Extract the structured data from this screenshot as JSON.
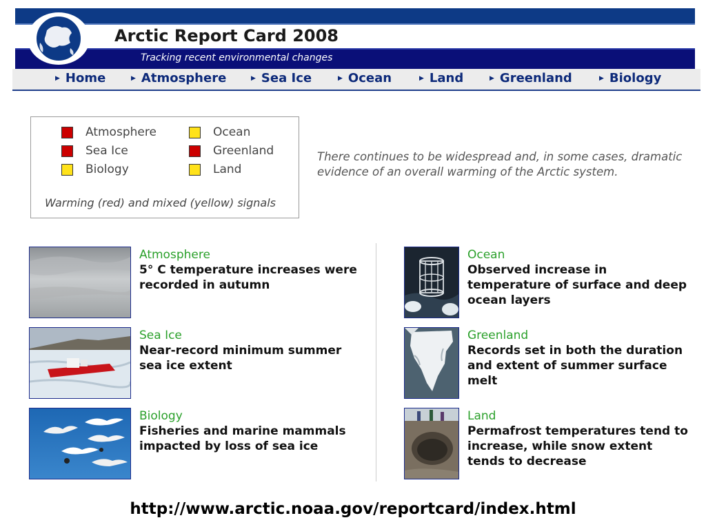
{
  "header": {
    "title": "Arctic Report Card 2008",
    "tagline": "Tracking recent environmental changes",
    "logo_icon": "arctic-globe-icon"
  },
  "nav": [
    {
      "label": "Home"
    },
    {
      "label": "Atmosphere"
    },
    {
      "label": "Sea Ice"
    },
    {
      "label": "Ocean"
    },
    {
      "label": "Land"
    },
    {
      "label": "Greenland"
    },
    {
      "label": "Biology"
    }
  ],
  "legend": {
    "items": [
      {
        "label": "Atmosphere",
        "signal": "red"
      },
      {
        "label": "Sea Ice",
        "signal": "red"
      },
      {
        "label": "Biology",
        "signal": "yellow"
      },
      {
        "label": "Ocean",
        "signal": "yellow"
      },
      {
        "label": "Greenland",
        "signal": "red"
      },
      {
        "label": "Land",
        "signal": "yellow"
      }
    ],
    "caption": "Warming (red) and mixed (yellow) signals",
    "colors": {
      "red": "#cc0000",
      "yellow": "#ffe21a"
    }
  },
  "intro": "There continues to be widespread and, in some cases, dramatic evidence of an overall warming of the Arctic system.",
  "topics": [
    {
      "category": "Atmosphere",
      "description": "5° C temperature increases were recorded in autumn",
      "image": "cloudy-sky-image"
    },
    {
      "category": "Sea Ice",
      "description": "Near-record minimum summer sea ice extent",
      "image": "icebreaker-ship-image"
    },
    {
      "category": "Biology",
      "description": "Fisheries and marine mammals impacted by loss of sea ice",
      "image": "flying-birds-image"
    },
    {
      "category": "Ocean",
      "description": "Observed increase in temperature of surface and deep ocean layers",
      "image": "ocean-instrument-image"
    },
    {
      "category": "Greenland",
      "description": "Records set in both the duration and extent of summer surface melt",
      "image": "greenland-satellite-image"
    },
    {
      "category": "Land",
      "description": "Permafrost temperatures tend to increase, while snow extent tends to decrease",
      "image": "permafrost-sinkhole-image"
    }
  ],
  "footer_url": "http://www.arctic.noaa.gov/reportcard/index.html",
  "accent_colors": {
    "header_dark": "#0a0f78",
    "nav_text": "#0d2a7a",
    "category_green": "#2aa02a"
  }
}
